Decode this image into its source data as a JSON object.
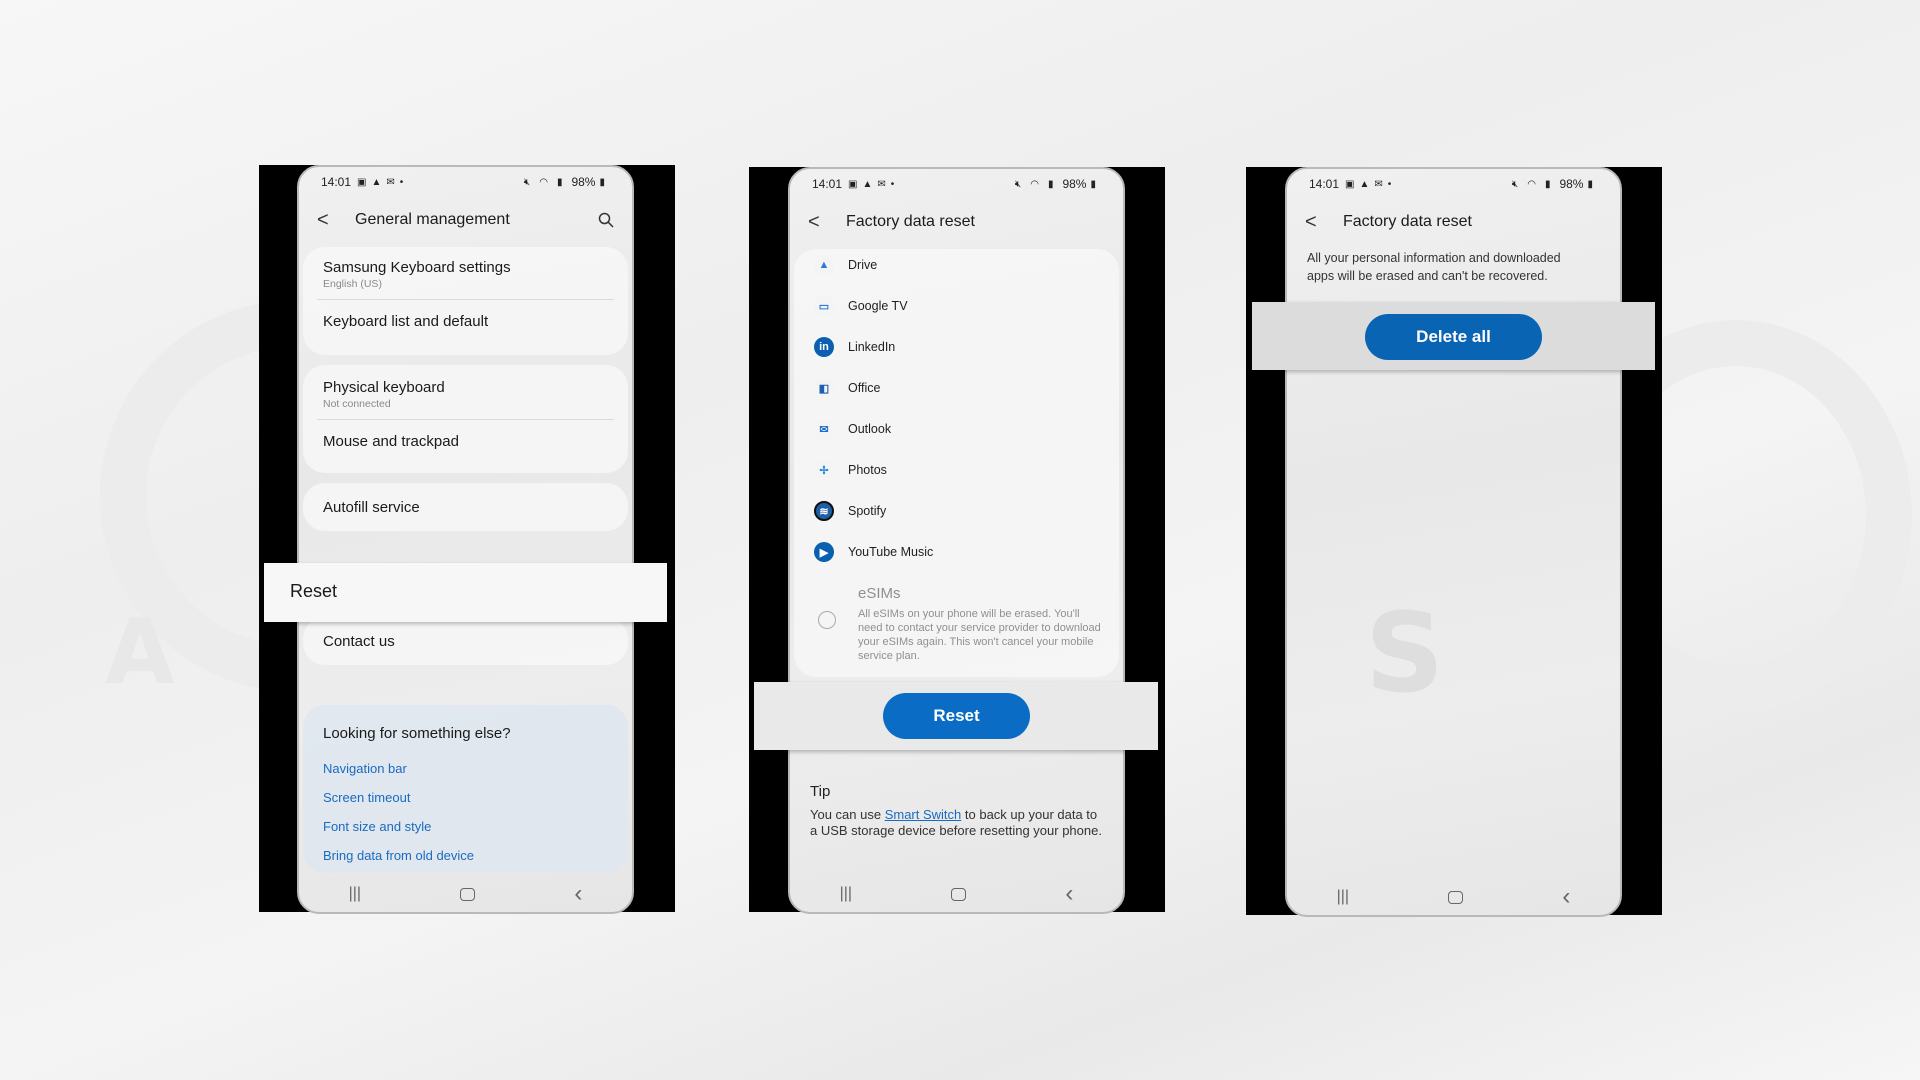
{
  "colors": {
    "accent_blue": "#0a6cc4",
    "link_blue": "#1a6bc0",
    "frame": "#000000"
  },
  "status_bar": {
    "time": "14:01",
    "left_icons": [
      "gallery-icon",
      "drive-notification-icon",
      "message-icon",
      "dot-icon"
    ],
    "right_icons": [
      "mute-icon",
      "wifi-icon",
      "signal-icon",
      "battery-icon"
    ],
    "battery": "98%"
  },
  "screen1": {
    "title": "General management",
    "groups": [
      {
        "items": [
          {
            "label": "Samsung Keyboard settings",
            "sub": "English (US)"
          },
          {
            "label": "Keyboard list and default",
            "sub": ""
          }
        ]
      },
      {
        "items": [
          {
            "label": "Physical keyboard",
            "sub": "Not connected"
          },
          {
            "label": "Mouse and trackpad",
            "sub": ""
          }
        ]
      },
      {
        "items": [
          {
            "label": "Autofill service",
            "sub": ""
          }
        ]
      }
    ],
    "highlighted_item": "Reset",
    "contact": "Contact us",
    "suggest_title": "Looking for something else?",
    "suggest_links": [
      "Navigation bar",
      "Screen timeout",
      "Font size and style",
      "Bring data from old device"
    ]
  },
  "screen2": {
    "title": "Factory data reset",
    "apps": [
      {
        "name": "Drive",
        "icon": "google-drive-icon"
      },
      {
        "name": "Google TV",
        "icon": "google-tv-icon"
      },
      {
        "name": "LinkedIn",
        "icon": "linkedin-icon"
      },
      {
        "name": "Office",
        "icon": "office-icon"
      },
      {
        "name": "Outlook",
        "icon": "outlook-icon"
      },
      {
        "name": "Photos",
        "icon": "photos-icon"
      },
      {
        "name": "Spotify",
        "icon": "spotify-icon"
      },
      {
        "name": "YouTube Music",
        "icon": "youtube-music-icon"
      }
    ],
    "esim_title": "eSIMs",
    "esim_desc": "All eSIMs on your phone will be erased. You'll need to contact your service provider to download your eSIMs again. This won't cancel your mobile service plan.",
    "esim_checked": false,
    "reset_button": "Reset",
    "tip_title": "Tip",
    "tip_prefix": "You can use ",
    "tip_link": "Smart Switch",
    "tip_suffix": " to back up your data to a USB storage device before resetting your phone."
  },
  "screen3": {
    "title": "Factory data reset",
    "warning": "All your personal information and downloaded apps will be erased and can't be recovered.",
    "delete_button": "Delete all"
  },
  "nav": {
    "recents": "|||",
    "back": "‹"
  }
}
